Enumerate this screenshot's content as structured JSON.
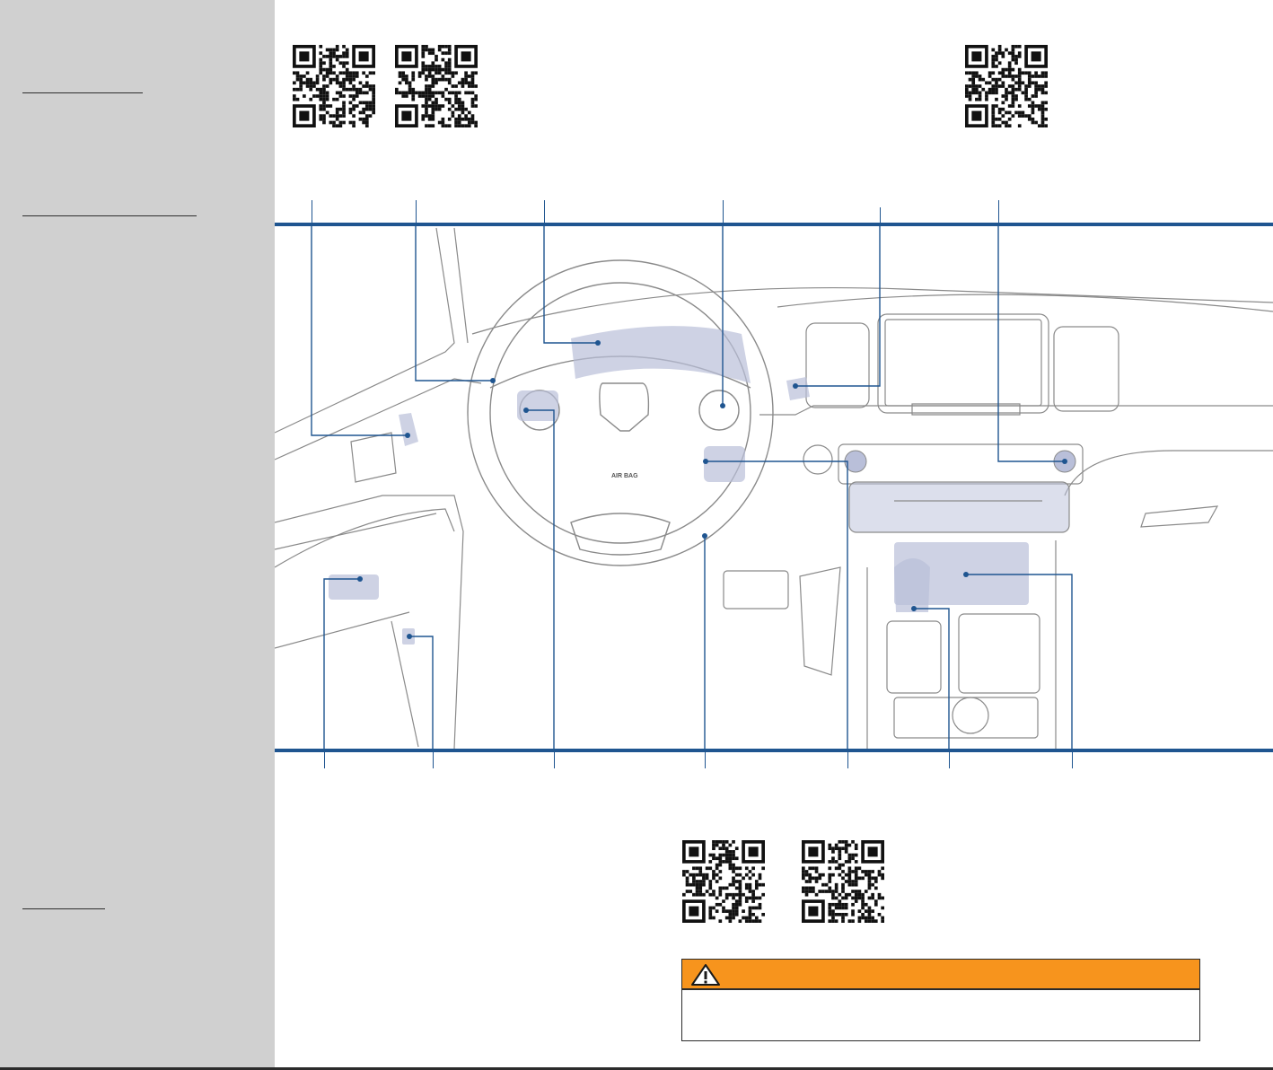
{
  "colors": {
    "sidebar": "#d0d0d0",
    "callout": "#1f5590",
    "highlight": "#b9bfd9",
    "warning": "#f7941d"
  },
  "icons": [
    "qr-code-icon",
    "warning-triangle-icon"
  ],
  "illustration": {
    "airbag_label": "AIR BAG"
  },
  "warning": {
    "title": "",
    "text": ""
  }
}
